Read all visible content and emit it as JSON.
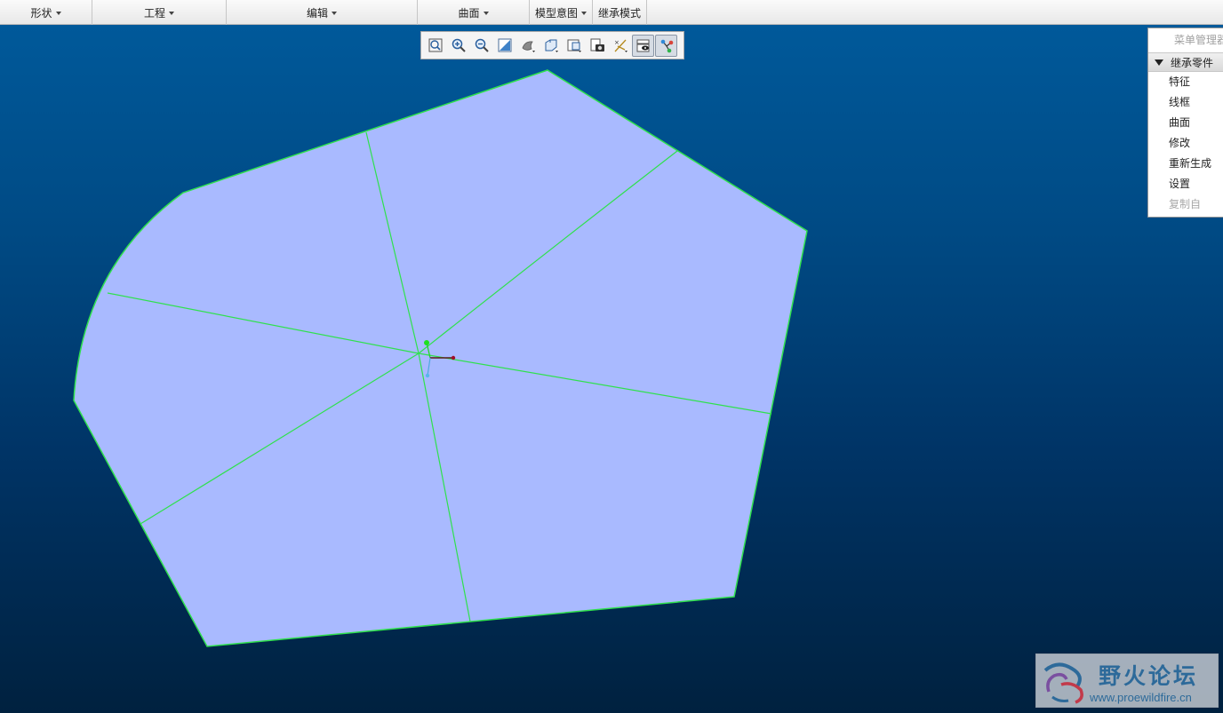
{
  "menubar": {
    "items": [
      {
        "label": "形状",
        "has_dropdown": true
      },
      {
        "label": "工程",
        "has_dropdown": true
      },
      {
        "label": "编辑",
        "has_dropdown": true
      },
      {
        "label": "曲面",
        "has_dropdown": true
      },
      {
        "label": "模型意图",
        "has_dropdown": true
      },
      {
        "label": "继承模式",
        "has_dropdown": false
      }
    ]
  },
  "graphics_toolbar": {
    "buttons": [
      {
        "icon": "refit-icon",
        "active": false
      },
      {
        "icon": "zoom-in-icon",
        "active": false
      },
      {
        "icon": "zoom-out-icon",
        "active": false
      },
      {
        "icon": "repaint-icon",
        "active": false
      },
      {
        "icon": "display-style-icon",
        "active": false
      },
      {
        "icon": "saved-orientations-icon",
        "active": false
      },
      {
        "icon": "view-manager-icon",
        "active": false
      },
      {
        "icon": "view-capture-icon",
        "active": false
      },
      {
        "icon": "datum-display-icon",
        "active": false
      },
      {
        "icon": "show-hide-icon",
        "active": true
      },
      {
        "icon": "annotation-display-icon",
        "active": true
      }
    ]
  },
  "menu_manager": {
    "title": "菜单管理器",
    "section": "继承零件",
    "items": [
      {
        "label": "特征",
        "enabled": true
      },
      {
        "label": "线框",
        "enabled": true
      },
      {
        "label": "曲面",
        "enabled": true
      },
      {
        "label": "修改",
        "enabled": true
      },
      {
        "label": "重新生成",
        "enabled": true
      },
      {
        "label": "设置",
        "enabled": true
      },
      {
        "label": "复制自",
        "enabled": false
      }
    ]
  },
  "viewport": {
    "surface_fill": "#a9baff",
    "edge_color": "#2fe14d",
    "background_top": "#00599a",
    "background_bottom": "#00213f"
  },
  "watermark": {
    "name": "野火论坛",
    "url": "www.proewildfire.cn"
  }
}
